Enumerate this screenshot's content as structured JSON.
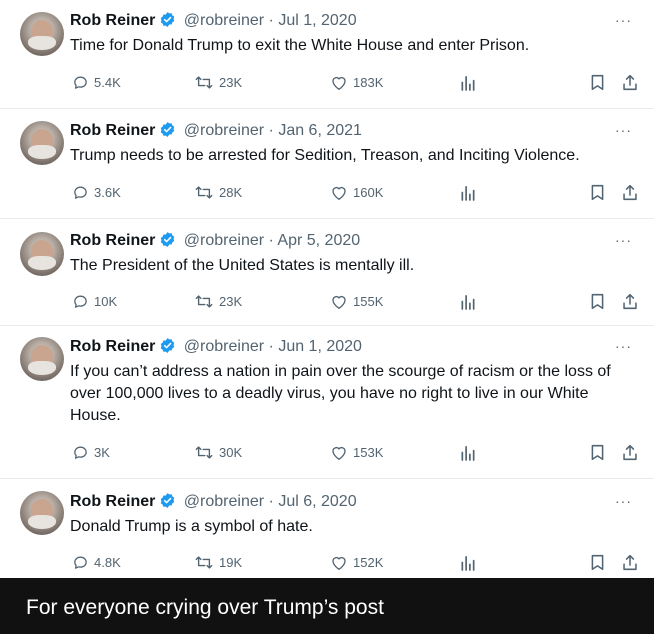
{
  "tweets": [
    {
      "name": "Rob Reiner",
      "handle": "@robreiner",
      "sep": "·",
      "date": "Jul 1, 2020",
      "text": "Time for Donald Trump to exit the White House and enter Prison.",
      "replies": "5.4K",
      "retweets": "23K",
      "likes": "183K"
    },
    {
      "name": "Rob Reiner",
      "handle": "@robreiner",
      "sep": "·",
      "date": "Jan 6, 2021",
      "text": "Trump needs to be arrested for Sedition, Treason, and Inciting Violence.",
      "replies": "3.6K",
      "retweets": "28K",
      "likes": "160K"
    },
    {
      "name": "Rob Reiner",
      "handle": "@robreiner",
      "sep": "·",
      "date": "Apr 5, 2020",
      "text": "The President of the United States is mentally ill.",
      "replies": "10K",
      "retweets": "23K",
      "likes": "155K"
    },
    {
      "name": "Rob Reiner",
      "handle": "@robreiner",
      "sep": "·",
      "date": "Jun 1, 2020",
      "text": "If you can’t address a nation in pain over the scourge of racism or the loss of over 100,000 lives to a deadly virus, you have no right to live in our White House.",
      "replies": "3K",
      "retweets": "30K",
      "likes": "153K"
    },
    {
      "name": "Rob Reiner",
      "handle": "@robreiner",
      "sep": "·",
      "date": "Jul 6, 2020",
      "text": "Donald Trump is a symbol of hate.",
      "replies": "4.8K",
      "retweets": "19K",
      "likes": "152K"
    }
  ],
  "more_label": "···",
  "caption": "For everyone crying over Trump’s post",
  "colors": {
    "verified": "#1d9bf0",
    "muted": "#536471",
    "footer_bg": "#111111"
  }
}
